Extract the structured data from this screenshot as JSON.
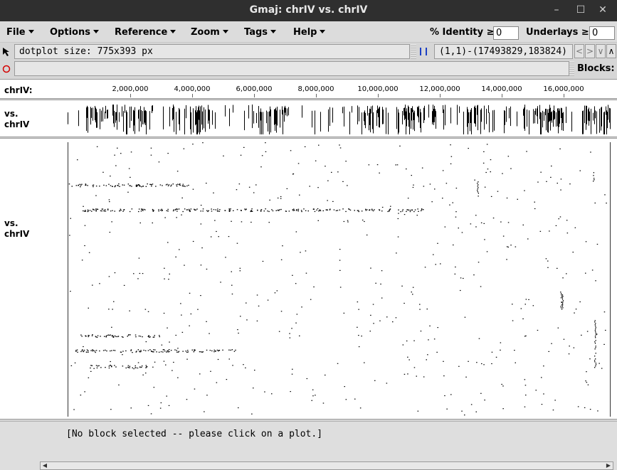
{
  "window": {
    "title": "Gmaj: chrIV vs. chrIV",
    "minimize": "–",
    "maximize": "☐",
    "close": "✕"
  },
  "menubar": {
    "menus": [
      "File",
      "Options",
      "Reference",
      "Zoom",
      "Tags",
      "Help"
    ],
    "identity_label": "% Identity ≥",
    "identity_value": "0",
    "underlays_label": "Underlays ≥",
    "underlays_value": "0"
  },
  "toolbar": {
    "pointer_icon": "arrow-pointer-icon",
    "dotplot_size": "dotplot size: 775x393 px",
    "divider_icon": "vertical-bars-icon",
    "range": "(1,1)-(17493829,183824)",
    "nav": {
      "back": "<",
      "forward": ">",
      "down": "∨",
      "up": "∧"
    }
  },
  "row2": {
    "circle_icon": "red-circle-icon",
    "input_value": "",
    "blocks_label": "Blocks:"
  },
  "ruler": {
    "sequence_label": "chrIV:",
    "ticks": [
      "2,000,000",
      "4,000,000",
      "6,000,000",
      "8,000,000",
      "10,000,000",
      "12,000,000",
      "14,000,000",
      "16,000,000"
    ]
  },
  "pip_panel": {
    "label_line1": "vs.",
    "label_line2": "chrIV"
  },
  "dotplot_panel": {
    "label_line1": "vs.",
    "label_line2": "chrIV"
  },
  "status": {
    "message": "[No block selected -- please click on a plot.]"
  },
  "colors": {
    "titlebar": "#2f2f2f",
    "background": "#d6d6d6",
    "dots": "#000000",
    "circle": "#d40000"
  }
}
